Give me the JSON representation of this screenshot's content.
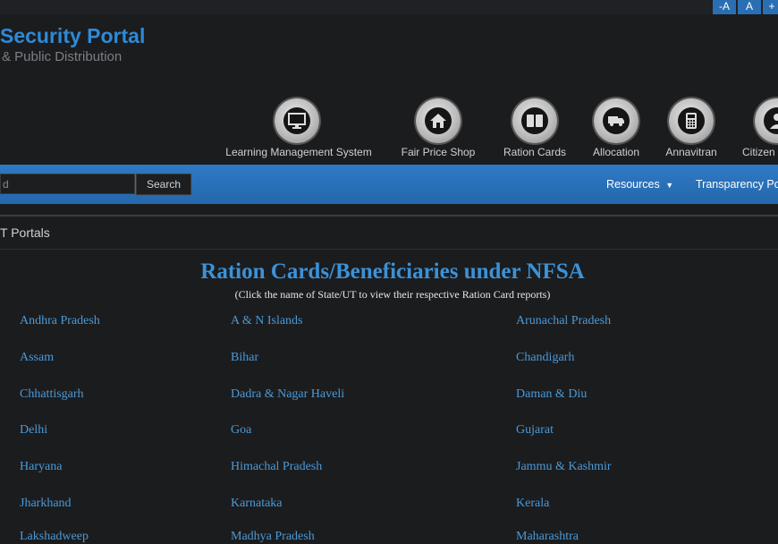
{
  "font_controls": {
    "decrease": "-A",
    "normal": "A",
    "increase": "+"
  },
  "logo": {
    "title": "Security Portal",
    "subtitle": "& Public Distribution"
  },
  "nav_icons": [
    {
      "label": "Learning Management System",
      "icon": "monitor-icon"
    },
    {
      "label": "Fair Price Shop",
      "icon": "house-icon"
    },
    {
      "label": "Ration Cards",
      "icon": "book-icon"
    },
    {
      "label": "Allocation",
      "icon": "truck-icon"
    },
    {
      "label": "Annavitran",
      "icon": "pos-terminal-icon"
    },
    {
      "label": "Citizen",
      "icon": "person-icon"
    }
  ],
  "search": {
    "value": "d",
    "button": "Search"
  },
  "menu": {
    "resources": "Resources",
    "transparency": "Transparency Po"
  },
  "breadcrumb": "T Portals",
  "heading": "Ration Cards/Beneficiaries under NFSA",
  "subheading": "(Click the name of State/UT to view their respective Ration Card reports)",
  "states": [
    [
      "Andhra Pradesh",
      "A & N Islands",
      "Arunachal Pradesh"
    ],
    [
      "Assam",
      "Bihar",
      "Chandigarh"
    ],
    [
      "Chhattisgarh",
      "Dadra & Nagar Haveli",
      "Daman & Diu"
    ],
    [
      "Delhi",
      "Goa",
      "Gujarat"
    ],
    [
      "Haryana",
      "Himachal Pradesh",
      "Jammu & Kashmir"
    ],
    [
      "Jharkhand",
      "Karnataka",
      "Kerala"
    ],
    [
      "Lakshadweep",
      "Madhya Pradesh",
      "Maharashtra"
    ]
  ],
  "colors": {
    "accent": "#2e8ad8",
    "bar": "#2a6fb3",
    "link": "#4a9ad8"
  }
}
